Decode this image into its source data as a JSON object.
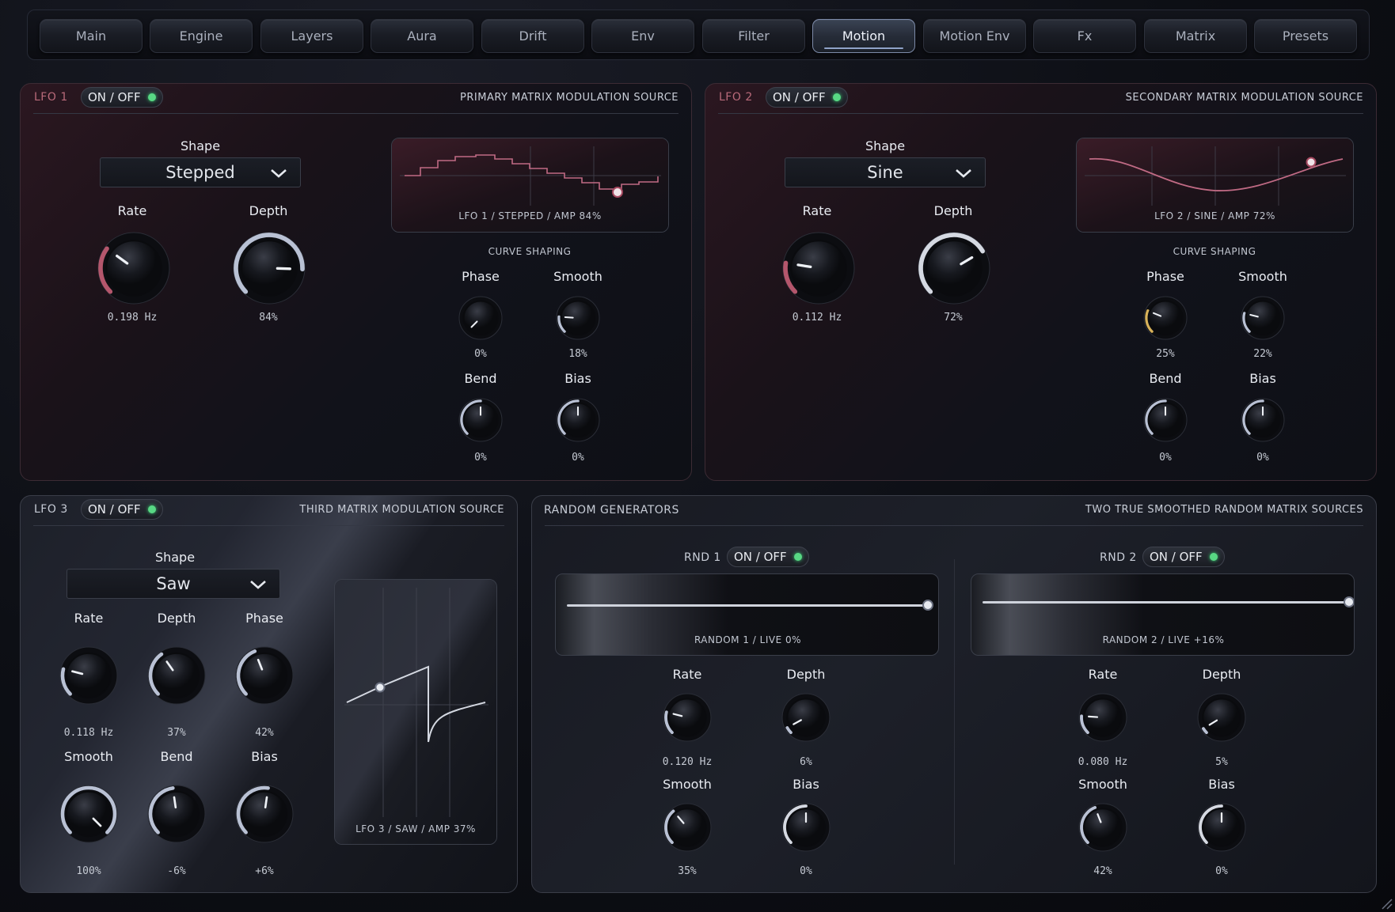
{
  "tabs": [
    {
      "label": "Main"
    },
    {
      "label": "Engine"
    },
    {
      "label": "Layers"
    },
    {
      "label": "Aura"
    },
    {
      "label": "Drift"
    },
    {
      "label": "Env"
    },
    {
      "label": "Filter"
    },
    {
      "label": "Motion",
      "active": true
    },
    {
      "label": "Motion Env"
    },
    {
      "label": "Fx"
    },
    {
      "label": "Matrix"
    },
    {
      "label": "Presets"
    }
  ],
  "toggle_label": "ON / OFF",
  "lfo1": {
    "title": "LFO 1",
    "description": "PRIMARY MATRIX MODULATION SOURCE",
    "shape_label": "Shape",
    "shape_value": "Stepped",
    "rate": {
      "label": "Rate",
      "value": "0.198 Hz",
      "level": 0.3
    },
    "depth": {
      "label": "Depth",
      "value": "84%",
      "level": 0.84
    },
    "scope_caption": "LFO 1 / STEPPED / AMP 84%",
    "curve_title": "CURVE SHAPING",
    "phase": {
      "label": "Phase",
      "value": "0%",
      "level": 0.0
    },
    "smooth": {
      "label": "Smooth",
      "value": "18%",
      "level": 0.18
    },
    "bend": {
      "label": "Bend",
      "value": "0%",
      "level": 0.5
    },
    "bias": {
      "label": "Bias",
      "value": "0%",
      "level": 0.5
    }
  },
  "lfo2": {
    "title": "LFO 2",
    "description": "SECONDARY MATRIX MODULATION SOURCE",
    "shape_label": "Shape",
    "shape_value": "Sine",
    "rate": {
      "label": "Rate",
      "value": "0.112 Hz",
      "level": 0.2
    },
    "depth": {
      "label": "Depth",
      "value": "72%",
      "level": 0.72
    },
    "scope_caption": "LFO 2 / SINE / AMP 72%",
    "curve_title": "CURVE SHAPING",
    "phase": {
      "label": "Phase",
      "value": "25%",
      "level": 0.25
    },
    "smooth": {
      "label": "Smooth",
      "value": "22%",
      "level": 0.22
    },
    "bend": {
      "label": "Bend",
      "value": "0%",
      "level": 0.5
    },
    "bias": {
      "label": "Bias",
      "value": "0%",
      "level": 0.5
    }
  },
  "lfo3": {
    "title": "LFO 3",
    "description": "THIRD MATRIX MODULATION SOURCE",
    "shape_label": "Shape",
    "shape_value": "Saw",
    "rate": {
      "label": "Rate",
      "value": "0.118 Hz",
      "level": 0.22
    },
    "depth": {
      "label": "Depth",
      "value": "37%",
      "level": 0.37
    },
    "phase": {
      "label": "Phase",
      "value": "42%",
      "level": 0.42
    },
    "smooth": {
      "label": "Smooth",
      "value": "100%",
      "level": 1.0
    },
    "bend": {
      "label": "Bend",
      "value": "-6%",
      "level": 0.47
    },
    "bias": {
      "label": "Bias",
      "value": "+6%",
      "level": 0.53
    },
    "scope_caption": "LFO 3 / SAW / AMP 37%"
  },
  "random": {
    "title": "RANDOM GENERATORS",
    "description": "TWO TRUE SMOOTHED RANDOM MATRIX SOURCES",
    "rnd1": {
      "title": "RND 1",
      "caption": "RANDOM 1 / LIVE 0%",
      "slider": 1.0,
      "rate": {
        "label": "Rate",
        "value": "0.120 Hz",
        "level": 0.22
      },
      "depth": {
        "label": "Depth",
        "value": "6%",
        "level": 0.06
      },
      "smooth": {
        "label": "Smooth",
        "value": "35%",
        "level": 0.35
      },
      "bias": {
        "label": "Bias",
        "value": "0%",
        "level": 0.5
      }
    },
    "rnd2": {
      "title": "RND 2",
      "caption": "RANDOM 2 / LIVE +16%",
      "slider": 1.0,
      "rate": {
        "label": "Rate",
        "value": "0.080 Hz",
        "level": 0.18
      },
      "depth": {
        "label": "Depth",
        "value": "5%",
        "level": 0.05
      },
      "smooth": {
        "label": "Smooth",
        "value": "42%",
        "level": 0.42
      },
      "bias": {
        "label": "Bias",
        "value": "0%",
        "level": 0.5
      }
    }
  },
  "colors": {
    "accent_red": "#b4566c",
    "accent_gold": "#d8b25a",
    "arc_light": "#b9c1d4",
    "led_green": "#58d884"
  }
}
